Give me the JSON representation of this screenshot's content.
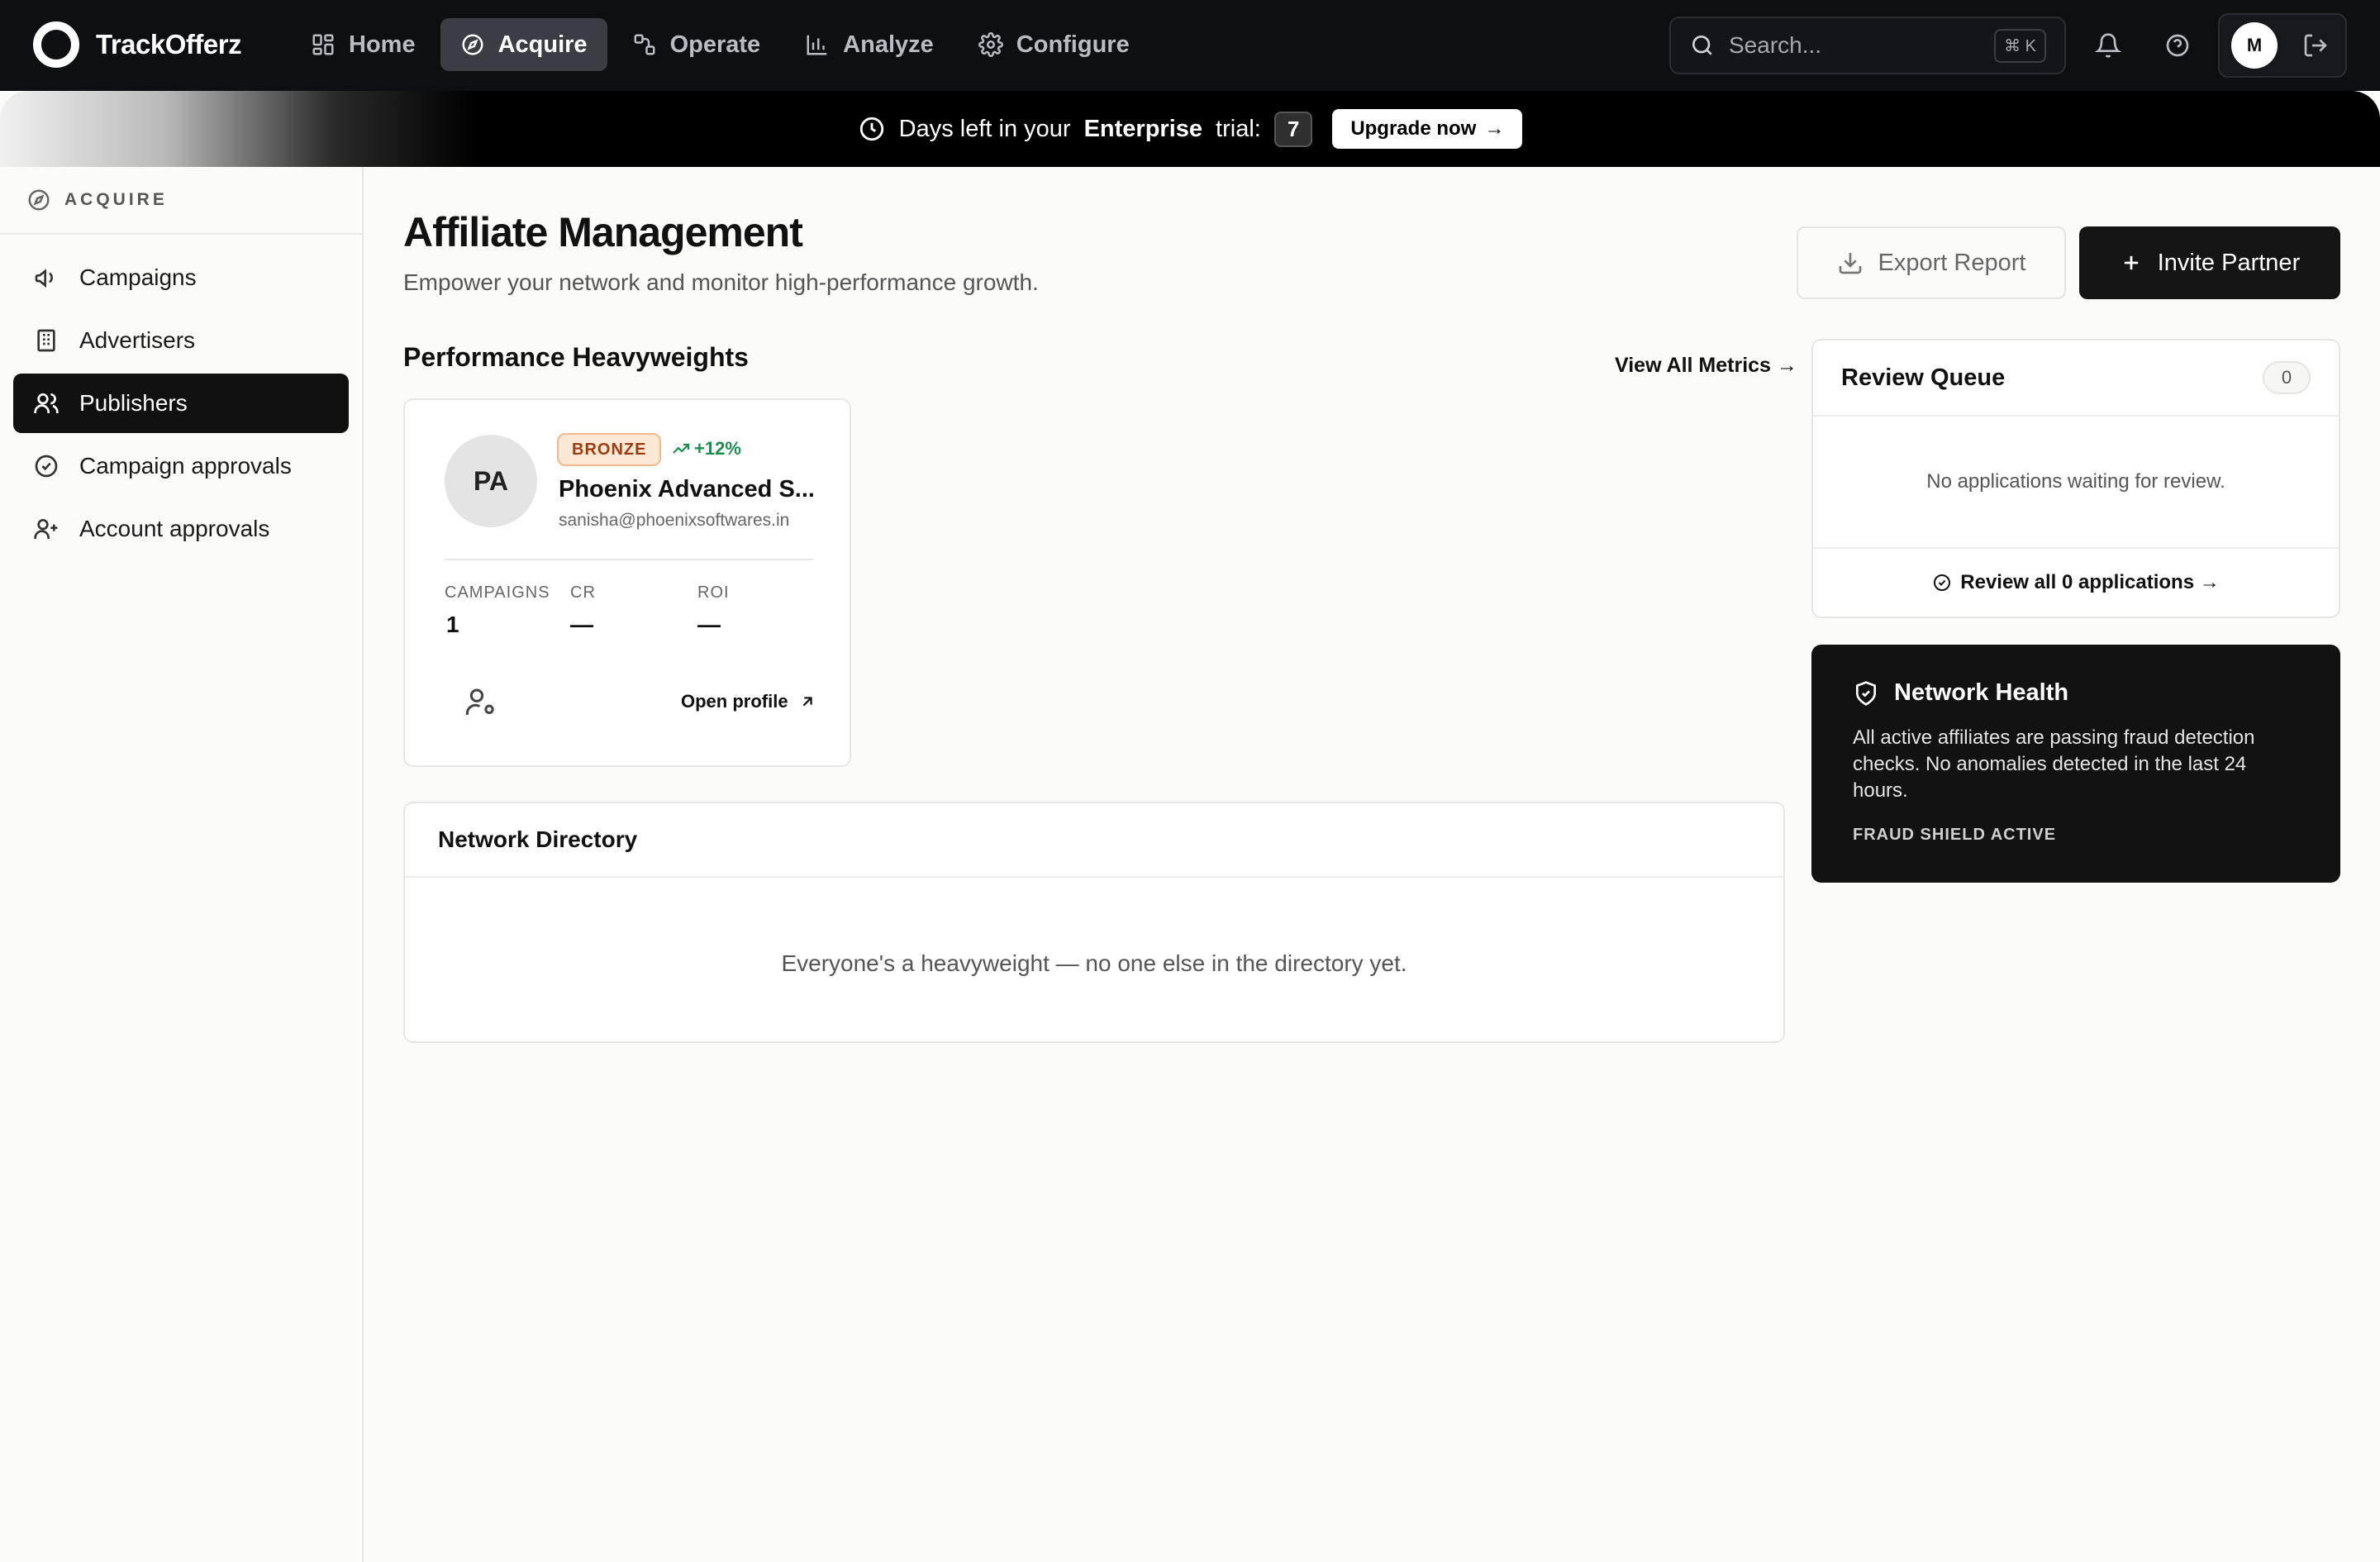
{
  "app": {
    "name": "TrackOfferz"
  },
  "nav": {
    "items": [
      {
        "label": "Home",
        "icon": "grid-icon"
      },
      {
        "label": "Acquire",
        "icon": "compass-icon",
        "active": true
      },
      {
        "label": "Operate",
        "icon": "nodes-icon"
      },
      {
        "label": "Analyze",
        "icon": "bar-chart-icon"
      },
      {
        "label": "Configure",
        "icon": "gear-icon"
      }
    ]
  },
  "search": {
    "placeholder": "Search...",
    "shortcut": "⌘ K"
  },
  "user": {
    "initial": "M"
  },
  "banner": {
    "prefix": "Days left in your",
    "plan": "Enterprise",
    "suffix": "trial:",
    "days": "7",
    "upgrade_label": "Upgrade now",
    "upgrade_arrow": "→"
  },
  "sidebar": {
    "section": "ACQUIRE",
    "items": [
      {
        "label": "Campaigns",
        "icon": "megaphone-icon"
      },
      {
        "label": "Advertisers",
        "icon": "building-icon"
      },
      {
        "label": "Publishers",
        "icon": "users-icon",
        "active": true
      },
      {
        "label": "Campaign approvals",
        "icon": "check-circle-icon"
      },
      {
        "label": "Account approvals",
        "icon": "user-plus-icon"
      }
    ]
  },
  "page": {
    "title": "Affiliate Management",
    "subtitle": "Empower your network and monitor high-performance growth.",
    "export_label": "Export Report",
    "invite_label": "Invite Partner"
  },
  "performance": {
    "title": "Performance Heavyweights",
    "view_all": "View All Metrics →",
    "publisher": {
      "initials": "PA",
      "tier": "BRONZE",
      "growth": "+12%",
      "name": "Phoenix Advanced S...",
      "email": "sanisha@phoenixsoftwares.in",
      "stats": [
        {
          "label": "CAMPAIGNS",
          "value": "1"
        },
        {
          "label": "CR",
          "value": "—"
        },
        {
          "label": "ROI",
          "value": "—"
        }
      ],
      "open_profile": "Open profile"
    }
  },
  "directory": {
    "title": "Network Directory",
    "empty": "Everyone's a heavyweight — no one else in the directory yet."
  },
  "review_queue": {
    "title": "Review Queue",
    "count": "0",
    "empty": "No applications waiting for review.",
    "link": "Review all 0 applications →"
  },
  "network_health": {
    "title": "Network Health",
    "description": "All active affiliates are passing fraud detection checks. No anomalies detected in the last 24 hours.",
    "status": "FRAUD SHIELD ACTIVE"
  }
}
